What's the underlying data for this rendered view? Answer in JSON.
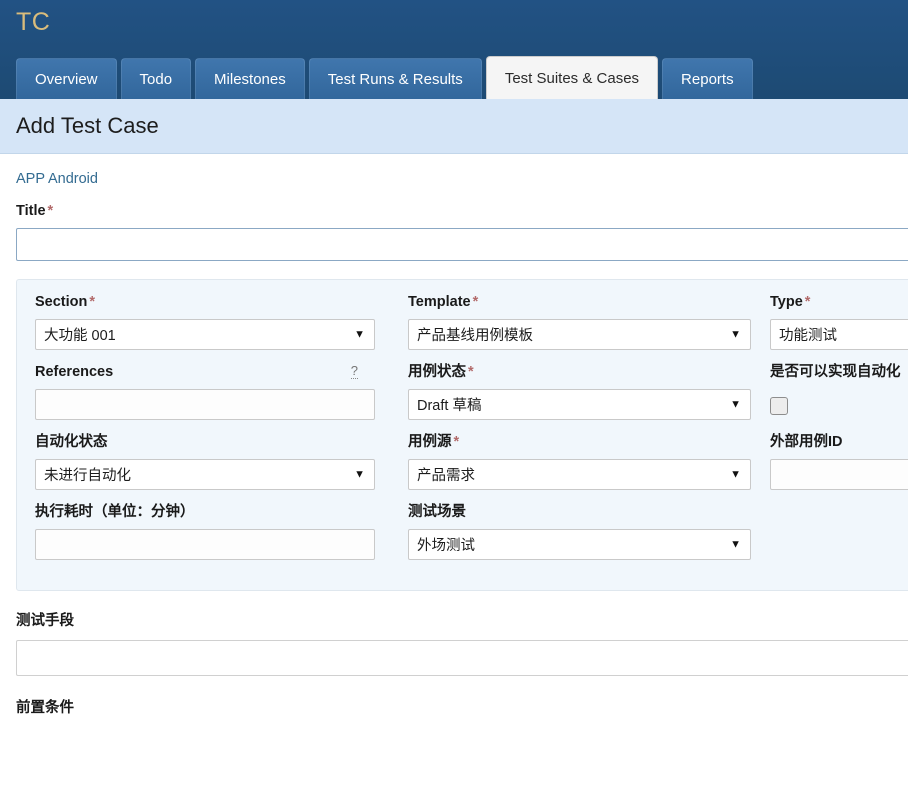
{
  "app": {
    "logo_text": "TC"
  },
  "nav": {
    "tabs": [
      {
        "label": "Overview",
        "active": false
      },
      {
        "label": "Todo",
        "active": false
      },
      {
        "label": "Milestones",
        "active": false
      },
      {
        "label": "Test Runs & Results",
        "active": false
      },
      {
        "label": "Test Suites & Cases",
        "active": true
      },
      {
        "label": "Reports",
        "active": false
      }
    ]
  },
  "page": {
    "header_title": "Add Test Case",
    "breadcrumb": "APP Android"
  },
  "title_field": {
    "label": "Title",
    "required_marker": "*",
    "value": "",
    "placeholder": ""
  },
  "form": {
    "columns": [
      {
        "fields": [
          {
            "label": "Section",
            "required_marker": "*",
            "control": "select",
            "value": "大功能 001",
            "caret": "▼"
          },
          {
            "label": "References",
            "required_marker": "",
            "control": "text",
            "value": "",
            "help": "?"
          },
          {
            "label": "自动化状态",
            "required_marker": "",
            "control": "select",
            "value": "未进行自动化",
            "caret": "▼"
          },
          {
            "label": "执行耗时（单位：分钟）",
            "required_marker": "",
            "control": "text",
            "value": ""
          }
        ]
      },
      {
        "fields": [
          {
            "label": "Template",
            "required_marker": "*",
            "control": "select",
            "value": "产品基线用例模板",
            "caret": "▼"
          },
          {
            "label": "用例状态",
            "required_marker": "*",
            "control": "select",
            "value": "Draft 草稿",
            "caret": "▼"
          },
          {
            "label": "用例源",
            "required_marker": "*",
            "control": "select",
            "value": "产品需求",
            "caret": "▼"
          },
          {
            "label": "测试场景",
            "required_marker": "",
            "control": "select",
            "value": "外场测试",
            "caret": "▼"
          }
        ]
      },
      {
        "fields": [
          {
            "label": "Type",
            "required_marker": "*",
            "control": "select",
            "value": "功能测试",
            "caret": "▼"
          },
          {
            "label": "是否可以实现自动化",
            "required_marker": "",
            "control": "checkbox",
            "checked": false
          },
          {
            "label": "外部用例ID",
            "required_marker": "",
            "control": "text",
            "value": ""
          }
        ]
      }
    ]
  },
  "below_fields": [
    {
      "label": "测试手段",
      "value": "",
      "control": "text"
    },
    {
      "label": "前置条件",
      "value": "",
      "control": "text"
    }
  ],
  "colors": {
    "navy": "#1f4e79",
    "tab_blue": "#3a6fa5",
    "logo_gold": "#d9bc7c",
    "header_blue": "#d5e5f7",
    "link_blue": "#336b91",
    "panel_bg": "#f1f7fc",
    "required_red": "#b26a6a"
  }
}
